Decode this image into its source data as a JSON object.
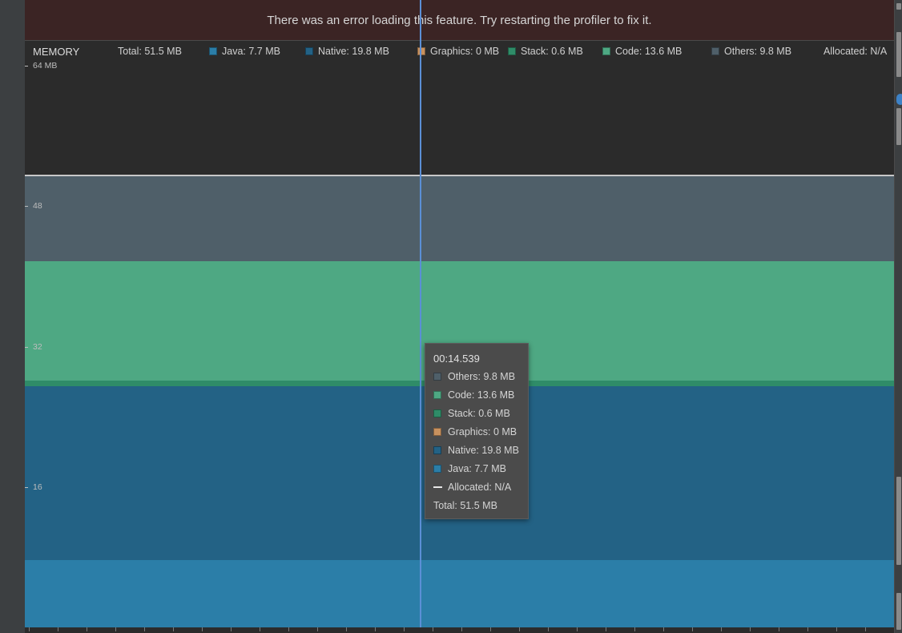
{
  "banner": {
    "message": "There was an error loading this feature. Try restarting the profiler to fix it."
  },
  "memory": {
    "section_title": "MEMORY",
    "legend": [
      {
        "key": "total",
        "label": "Total: 51.5 MB"
      },
      {
        "key": "java",
        "label": "Java: 7.7 MB",
        "color": "#2b7ea8"
      },
      {
        "key": "native",
        "label": "Native: 19.8 MB",
        "color": "#236285"
      },
      {
        "key": "graphics",
        "label": "Graphics: 0 MB",
        "color": "#c8915e"
      },
      {
        "key": "stack",
        "label": "Stack: 0.6 MB",
        "color": "#2f8c68"
      },
      {
        "key": "code",
        "label": "Code: 13.6 MB",
        "color": "#4ea883"
      },
      {
        "key": "others",
        "label": "Others: 9.8 MB",
        "color": "#4f5f69"
      },
      {
        "key": "allocated",
        "label": "Allocated: N/A"
      }
    ],
    "y_axis": {
      "max_label": "64 MB",
      "labels": [
        "48",
        "32",
        "16"
      ]
    }
  },
  "chart_data": {
    "type": "area",
    "title": "",
    "ylabel": "",
    "ylim": [
      0,
      64
    ],
    "y_unit": "MB",
    "y_ticks": [
      16,
      32,
      48,
      64
    ],
    "series": [
      {
        "name": "Java",
        "value": 7.7,
        "color": "#2b7ea8"
      },
      {
        "name": "Native",
        "value": 19.8,
        "color": "#236285"
      },
      {
        "name": "Graphics",
        "value": 0,
        "color": "#c8915e"
      },
      {
        "name": "Stack",
        "value": 0.6,
        "color": "#2f8c68"
      },
      {
        "name": "Code",
        "value": 13.6,
        "color": "#4ea883"
      },
      {
        "name": "Others",
        "value": 9.8,
        "color": "#4f5f69"
      }
    ],
    "total": 51.5
  },
  "tooltip": {
    "time": "00:14.539",
    "rows": [
      {
        "label": "Others: 9.8 MB",
        "color": "#4f5f69"
      },
      {
        "label": "Code: 13.6 MB",
        "color": "#4ea883"
      },
      {
        "label": "Stack: 0.6 MB",
        "color": "#2f8c68"
      },
      {
        "label": "Graphics: 0 MB",
        "color": "#c8915e"
      },
      {
        "label": "Native: 19.8 MB",
        "color": "#236285"
      },
      {
        "label": "Java: 7.7 MB",
        "color": "#2b7ea8"
      },
      {
        "label": "Allocated: N/A"
      }
    ],
    "total": "Total: 51.5 MB"
  }
}
